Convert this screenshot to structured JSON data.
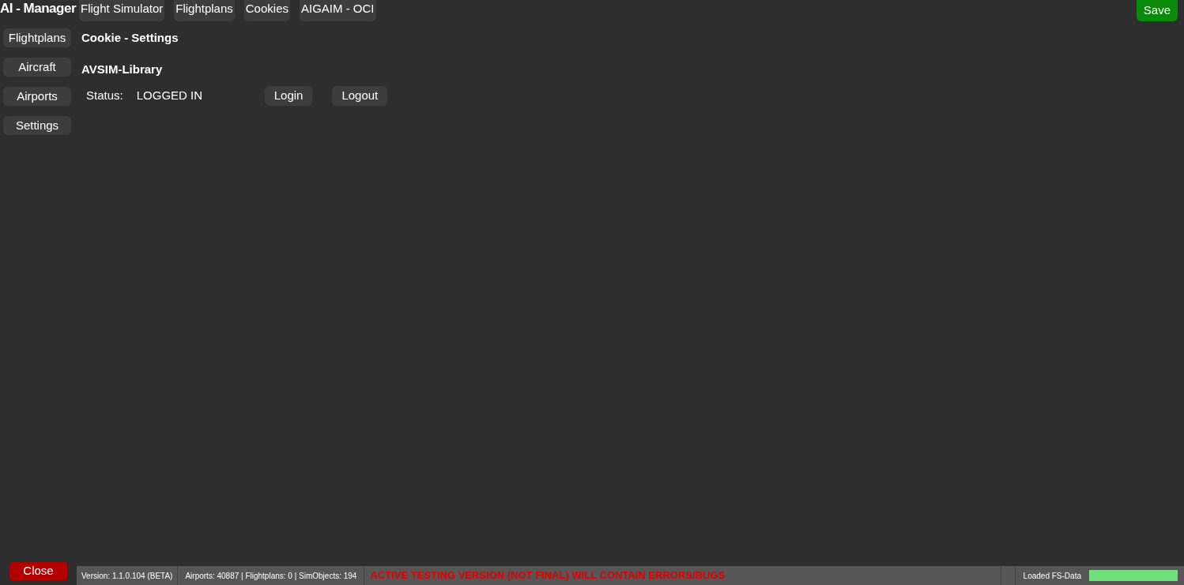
{
  "app": {
    "title": "AI - Manager"
  },
  "top_tabs": [
    "Flight Simulator",
    "Flightplans",
    "Cookies",
    "AIGAIM - OCI"
  ],
  "save_button": "Save",
  "sidebar": {
    "items": [
      "Flightplans",
      "Aircraft",
      "Airports",
      "Settings"
    ]
  },
  "content": {
    "heading": "Cookie - Settings",
    "section": "AVSIM-Library",
    "status_label": "Status:",
    "status_value": "LOGGED IN",
    "buttons": [
      "Login",
      "Logout"
    ]
  },
  "close_button": "Close",
  "status_bar": {
    "version": "Version: 1.1.0.104 (BETA)",
    "counts": "Airports: 40887 | Flightplans: 0 | SimObjects: 194",
    "warning": "ACTIVE TESTING VERSION (NOT FINAL) WILL CONTAIN ERRORS/BUGS",
    "progress_label": "Loaded FS-Data",
    "progress": {
      "level": 1
    }
  }
}
